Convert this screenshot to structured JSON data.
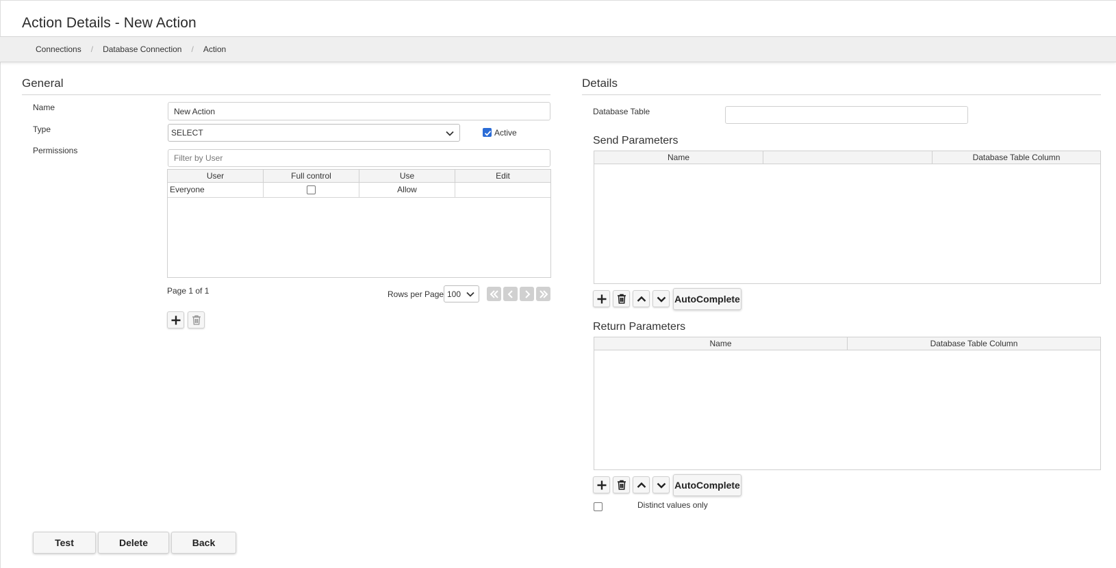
{
  "header": {
    "title": "Action Details - New Action",
    "breadcrumbs": [
      "Connections",
      "Database Connection",
      "Action"
    ]
  },
  "general": {
    "title": "General",
    "name_label": "Name",
    "name_value": "New Action",
    "type_label": "Type",
    "type_value": "SELECT",
    "active_label": "Active",
    "active_checked": true,
    "permissions_label": "Permissions",
    "filter_placeholder": "Filter by User",
    "columns": [
      "User",
      "Full control",
      "Use",
      "Edit"
    ],
    "rows": [
      {
        "user": "Everyone",
        "full_control": false,
        "use": "Allow",
        "edit": ""
      }
    ],
    "page_info": "Page 1 of 1",
    "rows_per_page_label": "Rows per Page",
    "rows_per_page_value": "100"
  },
  "details": {
    "title": "Details",
    "db_table_label": "Database Table",
    "db_table_value": "",
    "send_params": {
      "title": "Send Parameters",
      "columns": [
        "Name",
        "",
        "Database Table Column"
      ],
      "autocomplete_label": "AutoComplete"
    },
    "return_params": {
      "title": "Return Parameters",
      "columns": [
        "Name",
        "Database Table Column"
      ],
      "autocomplete_label": "AutoComplete"
    },
    "distinct_label": "Distinct values only",
    "distinct_checked": false
  },
  "footer": {
    "test_label": "Test",
    "delete_label": "Delete",
    "back_label": "Back"
  },
  "colors": {
    "accent": "#2b6cd6",
    "breadcrumb_bg": "#efefef",
    "button_bg": "#f6f6f6"
  }
}
